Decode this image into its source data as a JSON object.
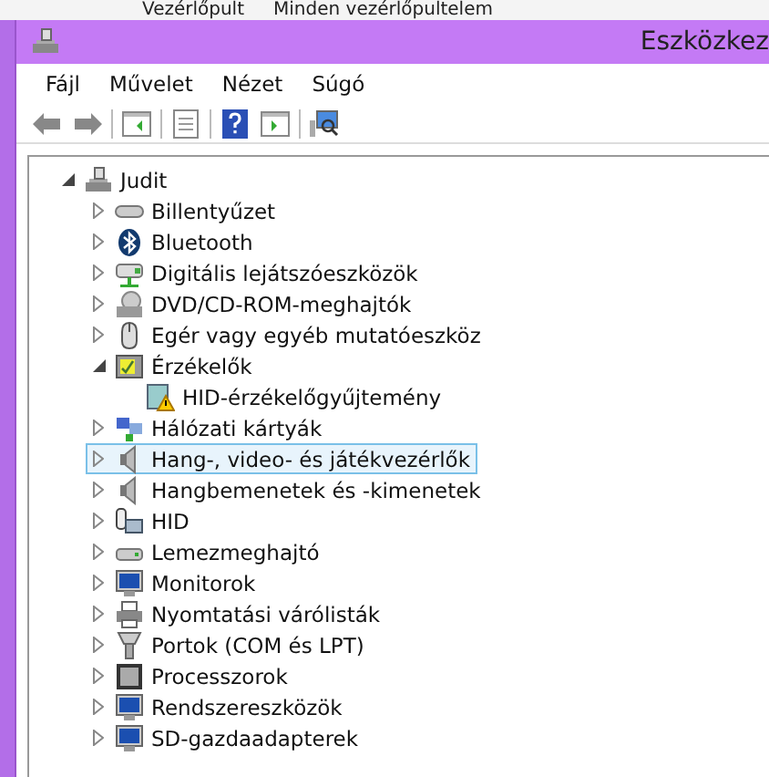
{
  "background_window": {
    "breadcrumbs": [
      "Vezérlőpult",
      "Minden vezérlőpultelem"
    ]
  },
  "window": {
    "title": "Eszközkez"
  },
  "menu": [
    "Fájl",
    "Művelet",
    "Nézet",
    "Súgó"
  ],
  "toolbar": [
    {
      "buttons": [
        {
          "kind": "back"
        },
        {
          "kind": "forward"
        }
      ]
    },
    {
      "buttons": [
        {
          "kind": "console-tree"
        }
      ]
    },
    {
      "buttons": [
        {
          "kind": "properties"
        }
      ]
    },
    {
      "buttons": [
        {
          "kind": "help"
        },
        {
          "kind": "action-pane"
        }
      ]
    },
    {
      "buttons": [
        {
          "kind": "scan"
        }
      ]
    }
  ],
  "tree": {
    "label": "Judit",
    "kind": "computer",
    "expanded": true,
    "selected": false,
    "children": [
      {
        "label": "Billentyűzet",
        "kind": "keyboard",
        "expanded": false,
        "selected": false
      },
      {
        "label": "Bluetooth",
        "kind": "bluetooth",
        "expanded": false,
        "selected": false
      },
      {
        "label": "Digitális lejátszóeszközök",
        "kind": "player",
        "expanded": false,
        "selected": false
      },
      {
        "label": "DVD/CD-ROM-meghajtók",
        "kind": "disc",
        "expanded": false,
        "selected": false
      },
      {
        "label": "Egér vagy egyéb mutatóeszköz",
        "kind": "mouse",
        "expanded": false,
        "selected": false
      },
      {
        "label": "Érzékelők",
        "kind": "sensor",
        "expanded": true,
        "selected": false,
        "children": [
          {
            "label": "HID-érzékelőgyűjtemény",
            "kind": "warning-device",
            "selected": false
          }
        ]
      },
      {
        "label": "Hálózati kártyák",
        "kind": "network",
        "expanded": false,
        "selected": false
      },
      {
        "label": "Hang-, video- és játékvezérlők",
        "kind": "speaker",
        "expanded": false,
        "selected": true
      },
      {
        "label": "Hangbemenetek és -kimenetek",
        "kind": "speaker",
        "expanded": false,
        "selected": false
      },
      {
        "label": "HID",
        "kind": "hid",
        "expanded": false,
        "selected": false
      },
      {
        "label": "Lemezmeghajtó",
        "kind": "drive",
        "expanded": false,
        "selected": false
      },
      {
        "label": "Monitorok",
        "kind": "monitor",
        "expanded": false,
        "selected": false
      },
      {
        "label": "Nyomtatási várólisták",
        "kind": "printer",
        "expanded": false,
        "selected": false
      },
      {
        "label": "Portok (COM és LPT)",
        "kind": "port",
        "expanded": false,
        "selected": false
      },
      {
        "label": "Processzorok",
        "kind": "chip",
        "expanded": false,
        "selected": false
      },
      {
        "label": "Rendszereszközök",
        "kind": "monitor",
        "expanded": false,
        "selected": false
      },
      {
        "label": "SD-gazdaadapterek",
        "kind": "monitor",
        "expanded": false,
        "selected": false
      }
    ]
  }
}
